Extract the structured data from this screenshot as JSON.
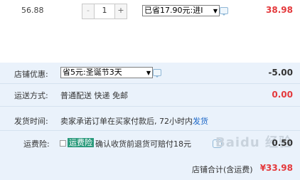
{
  "item": {
    "price": "56.88",
    "qty_minus": "-",
    "qty_value": "1",
    "qty_plus": "+",
    "discount_selected": "已省17.90元:进I",
    "subtotal": "38.98"
  },
  "shop": {
    "promo_label": "店铺优惠:",
    "promo_selected": "省5元:圣诞节3天",
    "promo_amount": "-5.00",
    "shipping_label": "运送方式:",
    "shipping_value": "普通配送 快递 免邮",
    "shipping_amount": "0.00",
    "delivery_label": "发货时间:",
    "delivery_text": "卖家承诺订单在买家付款后, 72小时内",
    "delivery_link": "发货",
    "insurance_label": "运费险:",
    "insurance_badge": "运费险",
    "insurance_text": "确认收货前退货可赔付18元",
    "insurance_help": "?",
    "insurance_amount": "0.50",
    "total_label": "店铺合计(含运费)",
    "total_amount": "¥33.98",
    "watermark": "Baidu 经验"
  },
  "colors": {
    "accent_red": "#e4393c",
    "panel_bg": "#eaf2fb",
    "badge_green": "#2a9a7c",
    "link_blue": "#1b66c7"
  }
}
